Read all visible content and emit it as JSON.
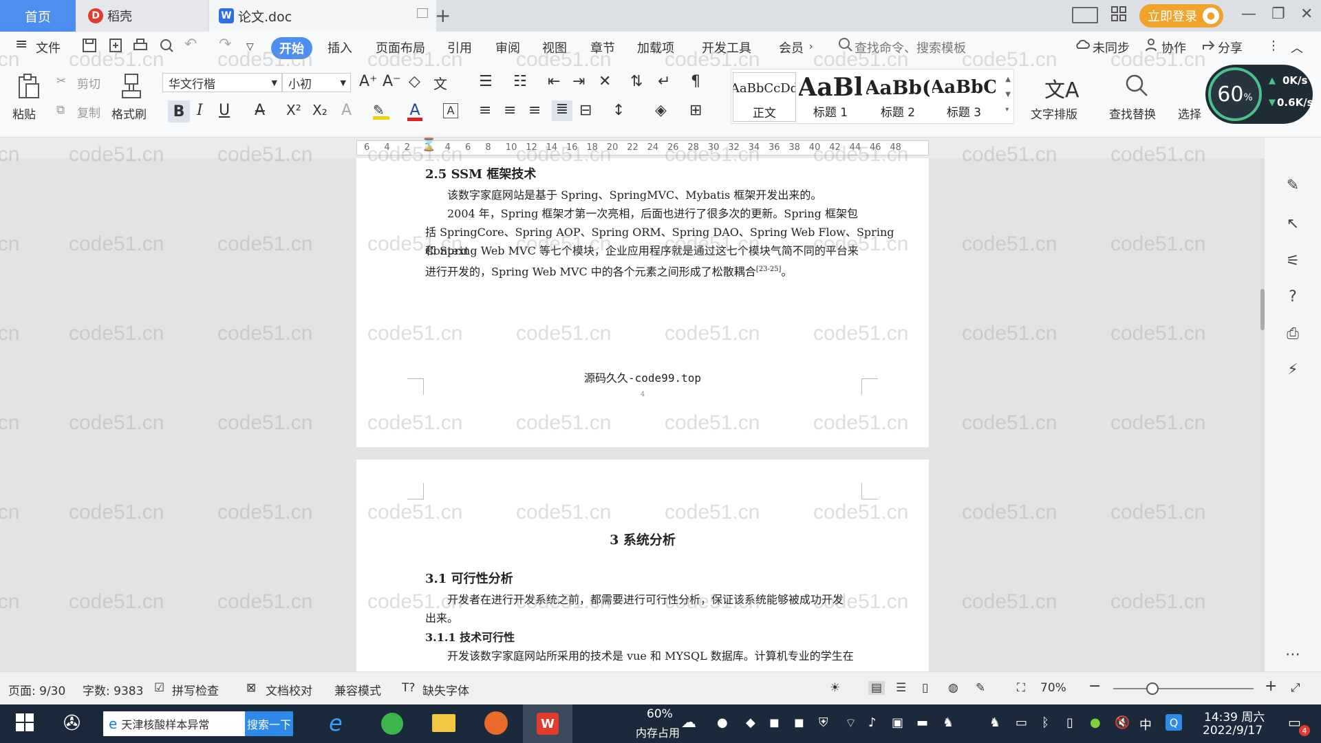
{
  "tabs": {
    "home": "首页",
    "docer": "稻壳",
    "doc": "论文.doc"
  },
  "titlebar": {
    "login": "立即登录"
  },
  "menu": {
    "file": "文件",
    "items": [
      "开始",
      "插入",
      "页面布局",
      "引用",
      "审阅",
      "视图",
      "章节",
      "加载项",
      "开发工具",
      "会员"
    ],
    "search_cmd": "查找命令、搜索模板",
    "unsync": "未同步",
    "collab": "协作",
    "share": "分享"
  },
  "ribbon": {
    "paste": "粘贴",
    "cut": "剪切",
    "copy": "复制",
    "format_painter": "格式刷",
    "font": "华文行楷",
    "size": "小初",
    "styles": [
      {
        "preview": "AaBbCcDd",
        "label": "正文"
      },
      {
        "preview": "AaBl",
        "label": "标题 1"
      },
      {
        "preview": "AaBb(",
        "label": "标题 2"
      },
      {
        "preview": "AaBbC",
        "label": "标题 3"
      }
    ],
    "text_layout": "文字排版",
    "find_replace": "查找替换",
    "select": "选择"
  },
  "gauge": {
    "percent": "60",
    "unit": "%",
    "up": "0K/s",
    "down": "0.6K/s"
  },
  "ruler": {
    "ticks": [
      "6",
      "4",
      "2",
      "2",
      "4",
      "6",
      "8",
      "10",
      "12",
      "14",
      "16",
      "18",
      "20",
      "22",
      "24",
      "26",
      "28",
      "30",
      "32",
      "34",
      "36",
      "38",
      "40",
      "42",
      "44",
      "46",
      "48"
    ]
  },
  "document": {
    "page1": {
      "heading": "2.5  SSM 框架技术",
      "p1": "该数字家庭网站是基于 Spring、SpringMVC、Mybatis 框架开发出来的。",
      "p2_l1": "2004 年，Spring 框架才第一次亮相，后面也进行了很多次的更新。Spring 框架包",
      "p2_l2": "括 SpringCore、Spring AOP、Spring ORM、Spring DAO、Spring Web Flow、Spring Context",
      "p2_l3": "和 Spring Web MVC 等七个模块，企业应用程序就是通过这七个模块气简不同的平台来",
      "p2_l4": "进行开发的，Spring Web MVC 中的各个元素之间形成了松散耦合",
      "cite": "[23-25]",
      "p2_end": "。",
      "footer": "源码久久-code99.top",
      "page_num": "4"
    },
    "page2": {
      "chapter": "3  系统分析",
      "section": "3.1  可行性分析",
      "p1_l1": "开发者在进行开发系统之前，都需要进行可行性分析，保证该系统能够被成功开发",
      "p1_l2": "出来。",
      "sub": "3.1.1  技术可行性",
      "p2_l1": "开发该数字家庭网站所采用的技术是 vue 和 MYSQL 数据库。计算机专业的学生在"
    },
    "watermark": "code51.cn"
  },
  "status": {
    "page": "页面: 9/30",
    "words": "字数: 9383",
    "spell": "拼写检查",
    "proof": "文档校对",
    "compat": "兼容模式",
    "missing_font": "缺失字体",
    "zoom": "70%",
    "zoom_fraction": 0.7
  },
  "taskbar": {
    "search_text": "天津核酸样本异常",
    "search_btn": "搜索一下",
    "mem_percent": "60%",
    "mem_label": "内存占用",
    "ime": "中",
    "time": "14:39 周六",
    "date": "2022/9/17",
    "notif_count": "4"
  }
}
